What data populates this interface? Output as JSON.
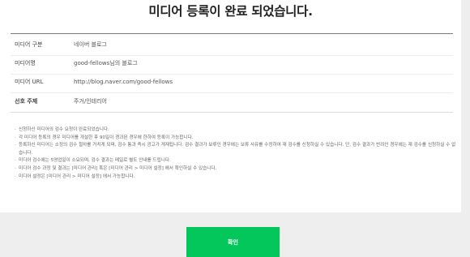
{
  "page_title": "미디어 등록이 완료 되었습니다.",
  "details": [
    {
      "label": "미디어 구분",
      "value": "네이버 블로그"
    },
    {
      "label": "미디어명",
      "value": "good-fellows님의 블로그"
    },
    {
      "label": "미디어 URL",
      "value": "http://blog.naver.com/good-fellows"
    },
    {
      "label": "선호 주제",
      "value": "주거/인테리어"
    }
  ],
  "notices": [
    "신청하신 미디어의 검수 요청이 완료되었습니다.",
    "각 미디어 등록의 경우 미디어를 개설한 후 90일이 경과된 경우에 한하여 등록이 가능합니다.",
    "등록하신 미디어는 소정의 검수 절차를 거치게 되며, 검수 통과 즉시 광고가 게재됩니다. 검수 결과가 보류인 경우에는 보류 사유를 수정하여 재 검수를 신청하실 수 있습니다. 단, 검수 결과가 반려인 경우에는 재 검수를 신청하실 수 없습니다.",
    "미디어 검수에는 5영업일이 소요되며, 검수 결과는 메일로 별도 안내를 드립니다.",
    "미디어 검수 과정 및 결과는 [미디어 관리] 혹은 [미디어 관리 > 미디어 설정] 에서 확인하실 수 있습니다.",
    "미디어 설정은 [미디어 관리 > 미디어 설정] 에서 가능합니다."
  ],
  "confirm_button": "확인",
  "colors": {
    "accent": "#03c75a",
    "background": "#eeeeee",
    "card": "#ffffff"
  }
}
